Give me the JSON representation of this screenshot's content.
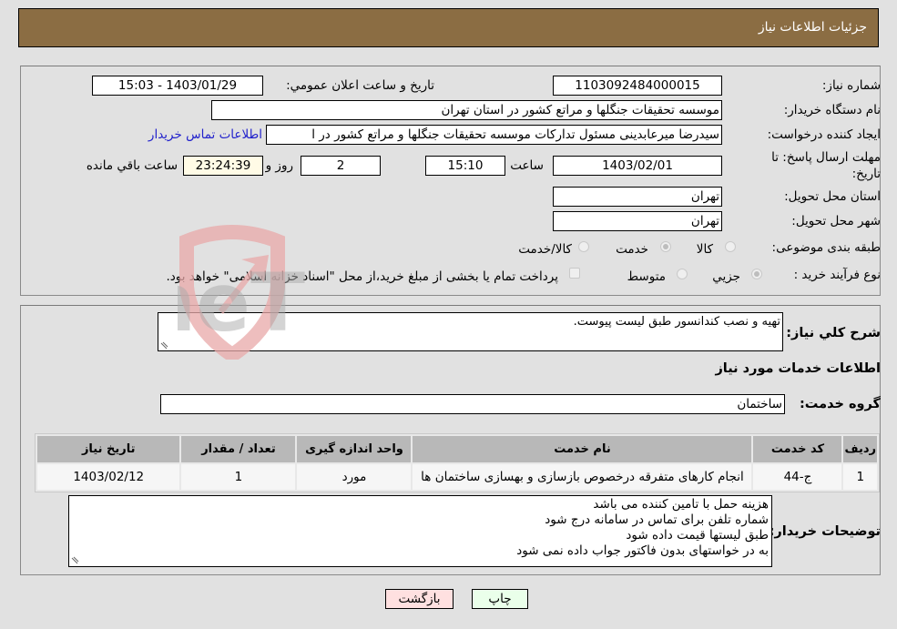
{
  "header": {
    "title": "جزئیات اطلاعات نیاز"
  },
  "colors": {
    "header_bg": "#8b6d43",
    "page_bg": "#e1e1e1",
    "link": "#2222cc",
    "remaining_bg": "#fffbe6",
    "back_button_bg": "#ffe0e0",
    "print_button_bg": "#eaffea",
    "table_header_bg": "#b8b8b8"
  },
  "details": {
    "need_number_label": "شماره نیاز:",
    "need_number": "1103092484000015",
    "announce_label": "تاریخ و ساعت اعلان عمومي:",
    "announce_value": "1403/01/29 - 15:03",
    "buyer_org_label": "نام دستگاه خریدار:",
    "buyer_org": "موسسه تحقیقات جنگلها و مراتع کشور در استان تهران",
    "requester_label": "ایجاد کننده درخواست:",
    "requester": "سیدرضا میرعابدینی مسئول تدارکات موسسه تحقیقات جنگلها و مراتع کشور در ا",
    "buyer_contact_link": "اطلاعات تماس خریدار",
    "deadline_label_1": "مهلت ارسال پاسخ: تا",
    "deadline_label_2": "تاریخ:",
    "deadline_date": "1403/02/01",
    "time_label": "ساعت",
    "deadline_time": "15:10",
    "days_value": "2",
    "days_label": "روز و",
    "remaining_time": "23:24:39",
    "remaining_label": "ساعت باقي مانده",
    "province_label": "استان محل تحویل:",
    "province": "تهران",
    "city_label": "شهر محل تحویل:",
    "city": "تهران",
    "category_label": "طبقه بندی موضوعی:",
    "category_options": [
      {
        "label": "کالا",
        "selected": false
      },
      {
        "label": "خدمت",
        "selected": true
      },
      {
        "label": "کالا/خدمت",
        "selected": false
      }
    ],
    "process_label": "نوع فرآیند خرید :",
    "process_options": [
      {
        "label": "جزيي",
        "selected": true
      },
      {
        "label": "متوسط",
        "selected": false
      }
    ],
    "treasury_note": "پرداخت تمام یا بخشی از مبلغ خرید،از محل \"اسناد خزانه اسلامی\" خواهد بود.",
    "treasury_checked": false
  },
  "need": {
    "description_label": "شرح کلي نياز:",
    "description": "تهیه و نصب کندانسور طبق لیست پیوست.",
    "services_heading": "اطلاعات خدمات مورد نياز",
    "service_group_label": "گروه خدمت:",
    "service_group": "ساختمان"
  },
  "table": {
    "headers": [
      "ردیف",
      "کد خدمت",
      "نام خدمت",
      "واحد اندازه گیری",
      "تعداد / مقدار",
      "تاریخ نیاز"
    ],
    "rows": [
      [
        "1",
        "ج-44",
        "انجام کارهای متفرقه درخصوص بازسازی و بهسازی ساختمان ها",
        "مورد",
        "1",
        "1403/02/12"
      ]
    ]
  },
  "buyer_notes": {
    "label": "توضیحات خریدار:",
    "lines": [
      "هزینه حمل با تامین کننده می باشد",
      "شماره تلفن برای تماس در سامانه درج شود",
      "طبق لیستها قیمت داده شود",
      "به در خواستهای بدون فاکتور جواب داده نمی شود"
    ]
  },
  "buttons": {
    "print": "چاپ",
    "back": "بازگشت"
  },
  "watermark": {
    "text": "AriaTender.neT"
  }
}
